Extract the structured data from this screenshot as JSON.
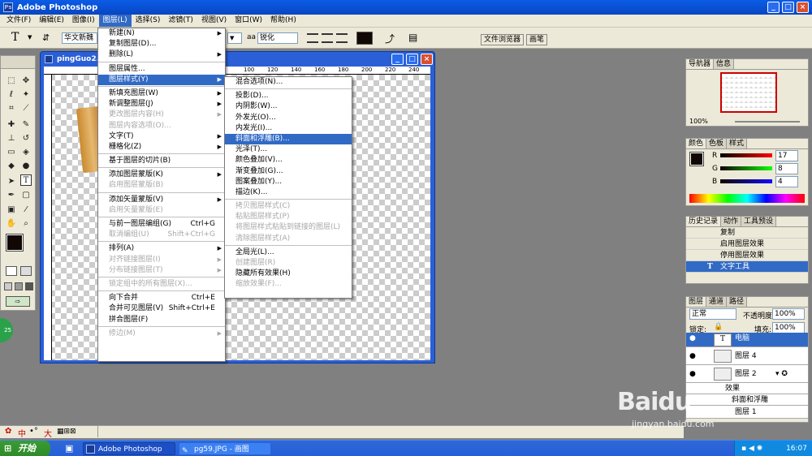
{
  "app": {
    "title": "Adobe Photoshop"
  },
  "menubar": [
    {
      "label": "文件(F)"
    },
    {
      "label": "编辑(E)"
    },
    {
      "label": "图像(I)"
    },
    {
      "label": "图层(L)"
    },
    {
      "label": "选择(S)"
    },
    {
      "label": "滤镜(T)"
    },
    {
      "label": "视图(V)"
    },
    {
      "label": "窗口(W)"
    },
    {
      "label": "帮助(H)"
    }
  ],
  "options_bar": {
    "font_family": "华文新魏",
    "aa_label": "aa",
    "aa_mode": "锐化",
    "tab_file_browser": "文件浏览器",
    "tab_brushes": "画笔"
  },
  "document": {
    "title": "pingGuo2...",
    "ruler_marks": [
      "100",
      "120",
      "140",
      "160",
      "180",
      "200",
      "220",
      "240"
    ]
  },
  "layer_menu": [
    {
      "label": "新建(N)",
      "arrow": true
    },
    {
      "label": "复制图层(D)..."
    },
    {
      "label": "删除(L)",
      "arrow": true
    },
    {
      "sep": true
    },
    {
      "label": "图层属性..."
    },
    {
      "label": "图层样式(Y)",
      "arrow": true,
      "highlighted": true
    },
    {
      "sep": true
    },
    {
      "label": "新填充图层(W)",
      "arrow": true
    },
    {
      "label": "新调整图层(J)",
      "arrow": true
    },
    {
      "label": "更改图层内容(H)",
      "disabled": true,
      "arrow": true
    },
    {
      "label": "图层内容选项(O)...",
      "disabled": true
    },
    {
      "label": "文字(T)",
      "arrow": true
    },
    {
      "label": "栅格化(Z)",
      "arrow": true
    },
    {
      "sep": true
    },
    {
      "label": "基于图层的切片(B)"
    },
    {
      "sep": true
    },
    {
      "label": "添加图层蒙版(K)",
      "arrow": true
    },
    {
      "label": "启用图层蒙版(B)",
      "disabled": true
    },
    {
      "sep": true
    },
    {
      "label": "添加矢量蒙版(V)",
      "arrow": true
    },
    {
      "label": "启用矢量蒙版(E)",
      "disabled": true
    },
    {
      "sep": true
    },
    {
      "label": "与前一图层编组(G)",
      "shortcut": "Ctrl+G"
    },
    {
      "label": "取消编组(U)",
      "shortcut": "Shift+Ctrl+G",
      "disabled": true
    },
    {
      "sep": true
    },
    {
      "label": "排列(A)",
      "arrow": true
    },
    {
      "label": "对齐链接图层(I)",
      "disabled": true,
      "arrow": true
    },
    {
      "label": "分布链接图层(T)",
      "disabled": true,
      "arrow": true
    },
    {
      "sep": true
    },
    {
      "label": "锁定组中的所有图层(X)...",
      "disabled": true
    },
    {
      "sep": true
    },
    {
      "label": "向下合并",
      "shortcut": "Ctrl+E"
    },
    {
      "label": "合并可见图层(V)",
      "shortcut": "Shift+Ctrl+E"
    },
    {
      "label": "拼合图层(F)"
    },
    {
      "sep": true
    },
    {
      "label": "修边(M)",
      "disabled": true,
      "arrow": true
    }
  ],
  "style_submenu": [
    {
      "label": "混合选项(N)..."
    },
    {
      "sep": true
    },
    {
      "label": "投影(D)..."
    },
    {
      "label": "内阴影(W)..."
    },
    {
      "label": "外发光(O)..."
    },
    {
      "label": "内发光(I)..."
    },
    {
      "label": "斜面和浮雕(B)...",
      "highlighted": true
    },
    {
      "label": "光泽(T)..."
    },
    {
      "label": "颜色叠加(V)..."
    },
    {
      "label": "渐变叠加(G)..."
    },
    {
      "label": "图案叠加(Y)..."
    },
    {
      "label": "描边(K)..."
    },
    {
      "sep": true
    },
    {
      "label": "拷贝图层样式(C)",
      "disabled": true
    },
    {
      "label": "粘贴图层样式(P)",
      "disabled": true
    },
    {
      "label": "将图层样式粘贴到链接的图层(L)",
      "disabled": true
    },
    {
      "label": "清除图层样式(A)",
      "disabled": true
    },
    {
      "sep": true
    },
    {
      "label": "全局光(L)..."
    },
    {
      "label": "创建图层(R)",
      "disabled": true
    },
    {
      "label": "隐藏所有效果(H)"
    },
    {
      "label": "缩放效果(F)...",
      "disabled": true
    }
  ],
  "navigator": {
    "tabs": [
      "导航器",
      "信息"
    ],
    "zoom": "100%"
  },
  "color_panel": {
    "tabs": [
      "颜色",
      "色板",
      "样式"
    ],
    "r": "17",
    "g": "8",
    "b": "4",
    "r_label": "R",
    "g_label": "G",
    "b_label": "B"
  },
  "history": {
    "tabs": [
      "历史记录",
      "动作",
      "工具预设"
    ],
    "items": [
      "复制",
      "启用图层效果",
      "停用图层效果",
      "文字工具"
    ]
  },
  "layers": {
    "tabs": [
      "图层",
      "通道",
      "路径"
    ],
    "blend_mode": "正常",
    "opacity_label": "不透明度:",
    "opacity": "100%",
    "lock_label": "锁定:",
    "fill_label": "填充:",
    "fill": "100%",
    "rows": [
      "电脑",
      "图层 4",
      "图层 2"
    ],
    "effects_label": "效果",
    "effect_item": "斜面和浮雕",
    "bottom_row": "图层 1"
  },
  "taskbar": {
    "start": "开始",
    "tasks": [
      "Adobe Photoshop",
      "pg59.JPG - 画图"
    ],
    "time": "16:07"
  },
  "status": {
    "ime": "中",
    "ime2": "大"
  },
  "watermark": {
    "text": "Baidu",
    "sub": "jingyan.baidu.com"
  },
  "colors": {
    "highlight": "#316ac5",
    "titlebar": "#0a5ce6",
    "foreground_swatch": "#110804"
  }
}
